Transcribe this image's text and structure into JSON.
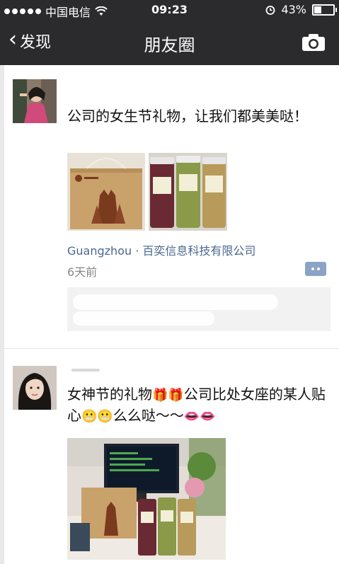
{
  "status_bar": {
    "carrier": "中国电信",
    "time": "09:23",
    "battery": "43%",
    "battery_level": 0.43
  },
  "nav": {
    "back_label": "发现",
    "title": "朋友圈",
    "camera_icon": "camera-icon"
  },
  "posts": [
    {
      "text": "公司的女生节礼物，让我们都美美哒！",
      "location": "Guangzhou · 百奕信息科技有限公司",
      "time_ago": "6天前"
    },
    {
      "text_parts": [
        "女神节的礼物",
        "公司比处女座的某人贴心",
        "么么哒～～"
      ],
      "emoji_icons": [
        "gift-icon",
        "gift-icon",
        "grin-face-icon",
        "grin-face-icon",
        "lips-icon",
        "lips-icon"
      ]
    }
  ],
  "colors": {
    "nav_bg": "#2b2b2d",
    "link_blue": "#4a6790",
    "comment_btn": "#8aa3c6"
  }
}
